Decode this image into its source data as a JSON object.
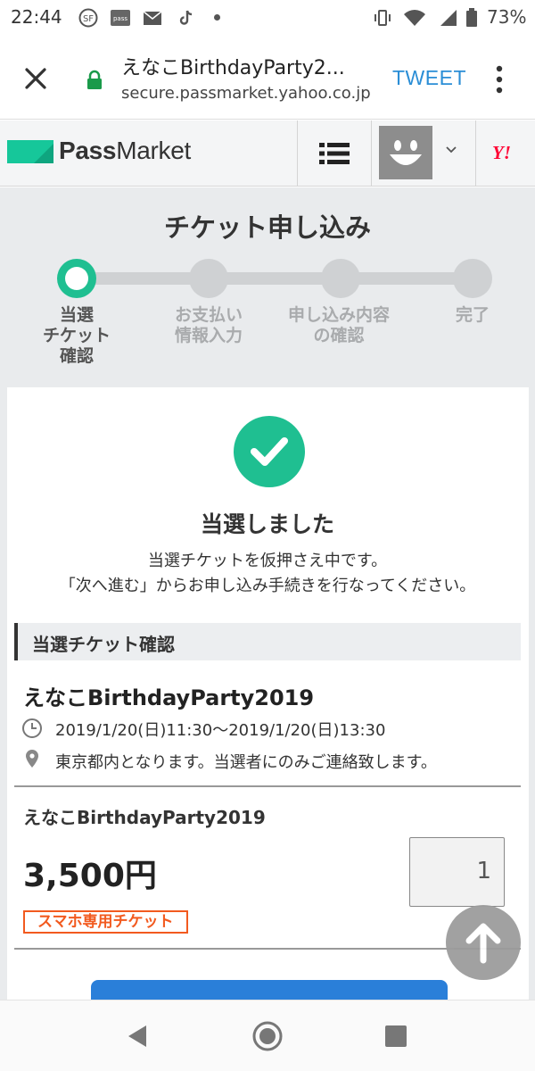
{
  "status_bar": {
    "time": "22:44",
    "notification_icons": [
      "sf-app-icon",
      "pass-app-icon",
      "au-mail-icon",
      "tiktok-icon",
      "more-dot-icon"
    ],
    "battery": "73%"
  },
  "browser": {
    "title": "えなこBirthdayParty2...",
    "url": "secure.passmarket.yahoo.co.jp",
    "tweet_label": "TWEET"
  },
  "site_header": {
    "logo_bold": "Pass",
    "logo_light": "Market",
    "yahoo_label": "Y!"
  },
  "page": {
    "heading": "チケット申し込み"
  },
  "stepper": {
    "steps": [
      {
        "label": "当選\nチケット\n確認",
        "active": true
      },
      {
        "label": "お支払い\n情報入力",
        "active": false
      },
      {
        "label": "申し込み内容\nの確認",
        "active": false
      },
      {
        "label": "完了",
        "active": false
      }
    ]
  },
  "result": {
    "title": "当選しました",
    "message_line1": "当選チケットを仮押さえ中です。",
    "message_line2": "「次へ進む」からお申し込み手続きを行なってください。"
  },
  "section": {
    "title": "当選チケット確認"
  },
  "event": {
    "name": "えなこBirthdayParty2019",
    "datetime": "2019/1/20(日)11:30〜2019/1/20(日)13:30",
    "location": "東京都内となります。当選者にのみご連絡致します。"
  },
  "ticket": {
    "name": "えなこBirthdayParty2019",
    "price": "3,500円",
    "quantity": "1",
    "badge": "スマホ専用チケット"
  },
  "colors": {
    "accent_green": "#1fbf91",
    "link_blue": "#2b8ed6",
    "badge_orange": "#f25a1f",
    "button_blue": "#2a7fd9"
  }
}
